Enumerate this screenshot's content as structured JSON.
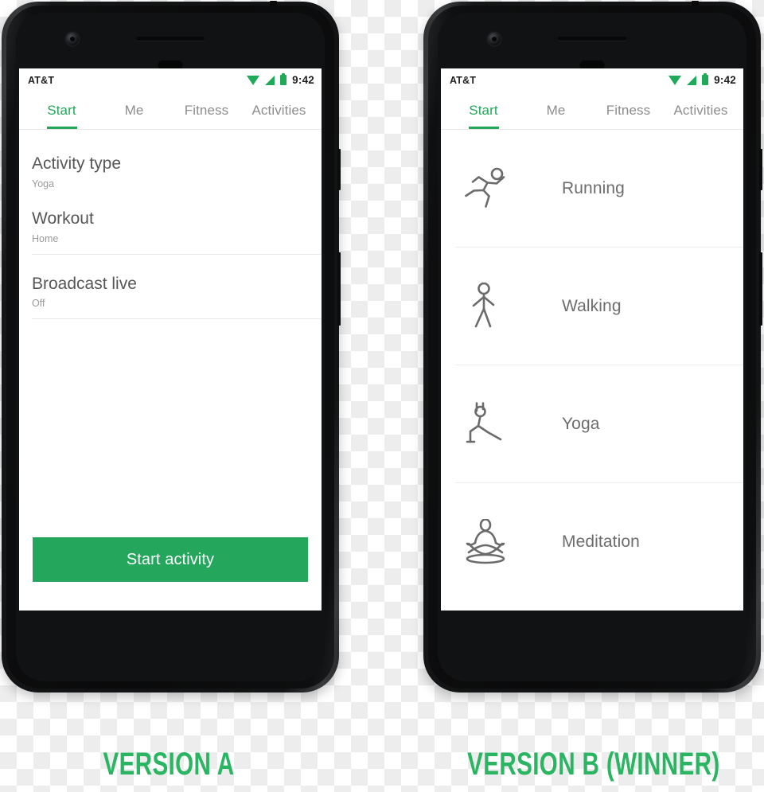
{
  "status_bar": {
    "carrier": "AT&T",
    "time": "9:42",
    "icons": [
      "wifi-icon",
      "signal-icon",
      "battery-icon"
    ],
    "accent_color": "#1faa59"
  },
  "tabs": [
    {
      "label": "Start",
      "active": true
    },
    {
      "label": "Me",
      "active": false
    },
    {
      "label": "Fitness",
      "active": false
    },
    {
      "label": "Activities",
      "active": false
    }
  ],
  "version_a": {
    "caption": "Version A",
    "settings": [
      {
        "title": "Activity type",
        "value": "Yoga"
      },
      {
        "title": "Workout",
        "value": "Home"
      },
      {
        "title": "Broadcast live",
        "value": "Off"
      }
    ],
    "cta_label": "Start activity",
    "cta_color": "#24a75c"
  },
  "version_b": {
    "caption": "Version B (Winner)",
    "activities": [
      {
        "label": "Running",
        "icon": "running-icon"
      },
      {
        "label": "Walking",
        "icon": "walking-icon"
      },
      {
        "label": "Yoga",
        "icon": "yoga-icon"
      },
      {
        "label": "Meditation",
        "icon": "meditation-icon"
      }
    ]
  },
  "colors": {
    "accent_green": "#22a75a",
    "caption_green": "#2bb563",
    "text_primary": "#565656",
    "text_secondary": "#9a9a9a",
    "divider": "#e9e9e9",
    "phone_body": "#111213"
  }
}
